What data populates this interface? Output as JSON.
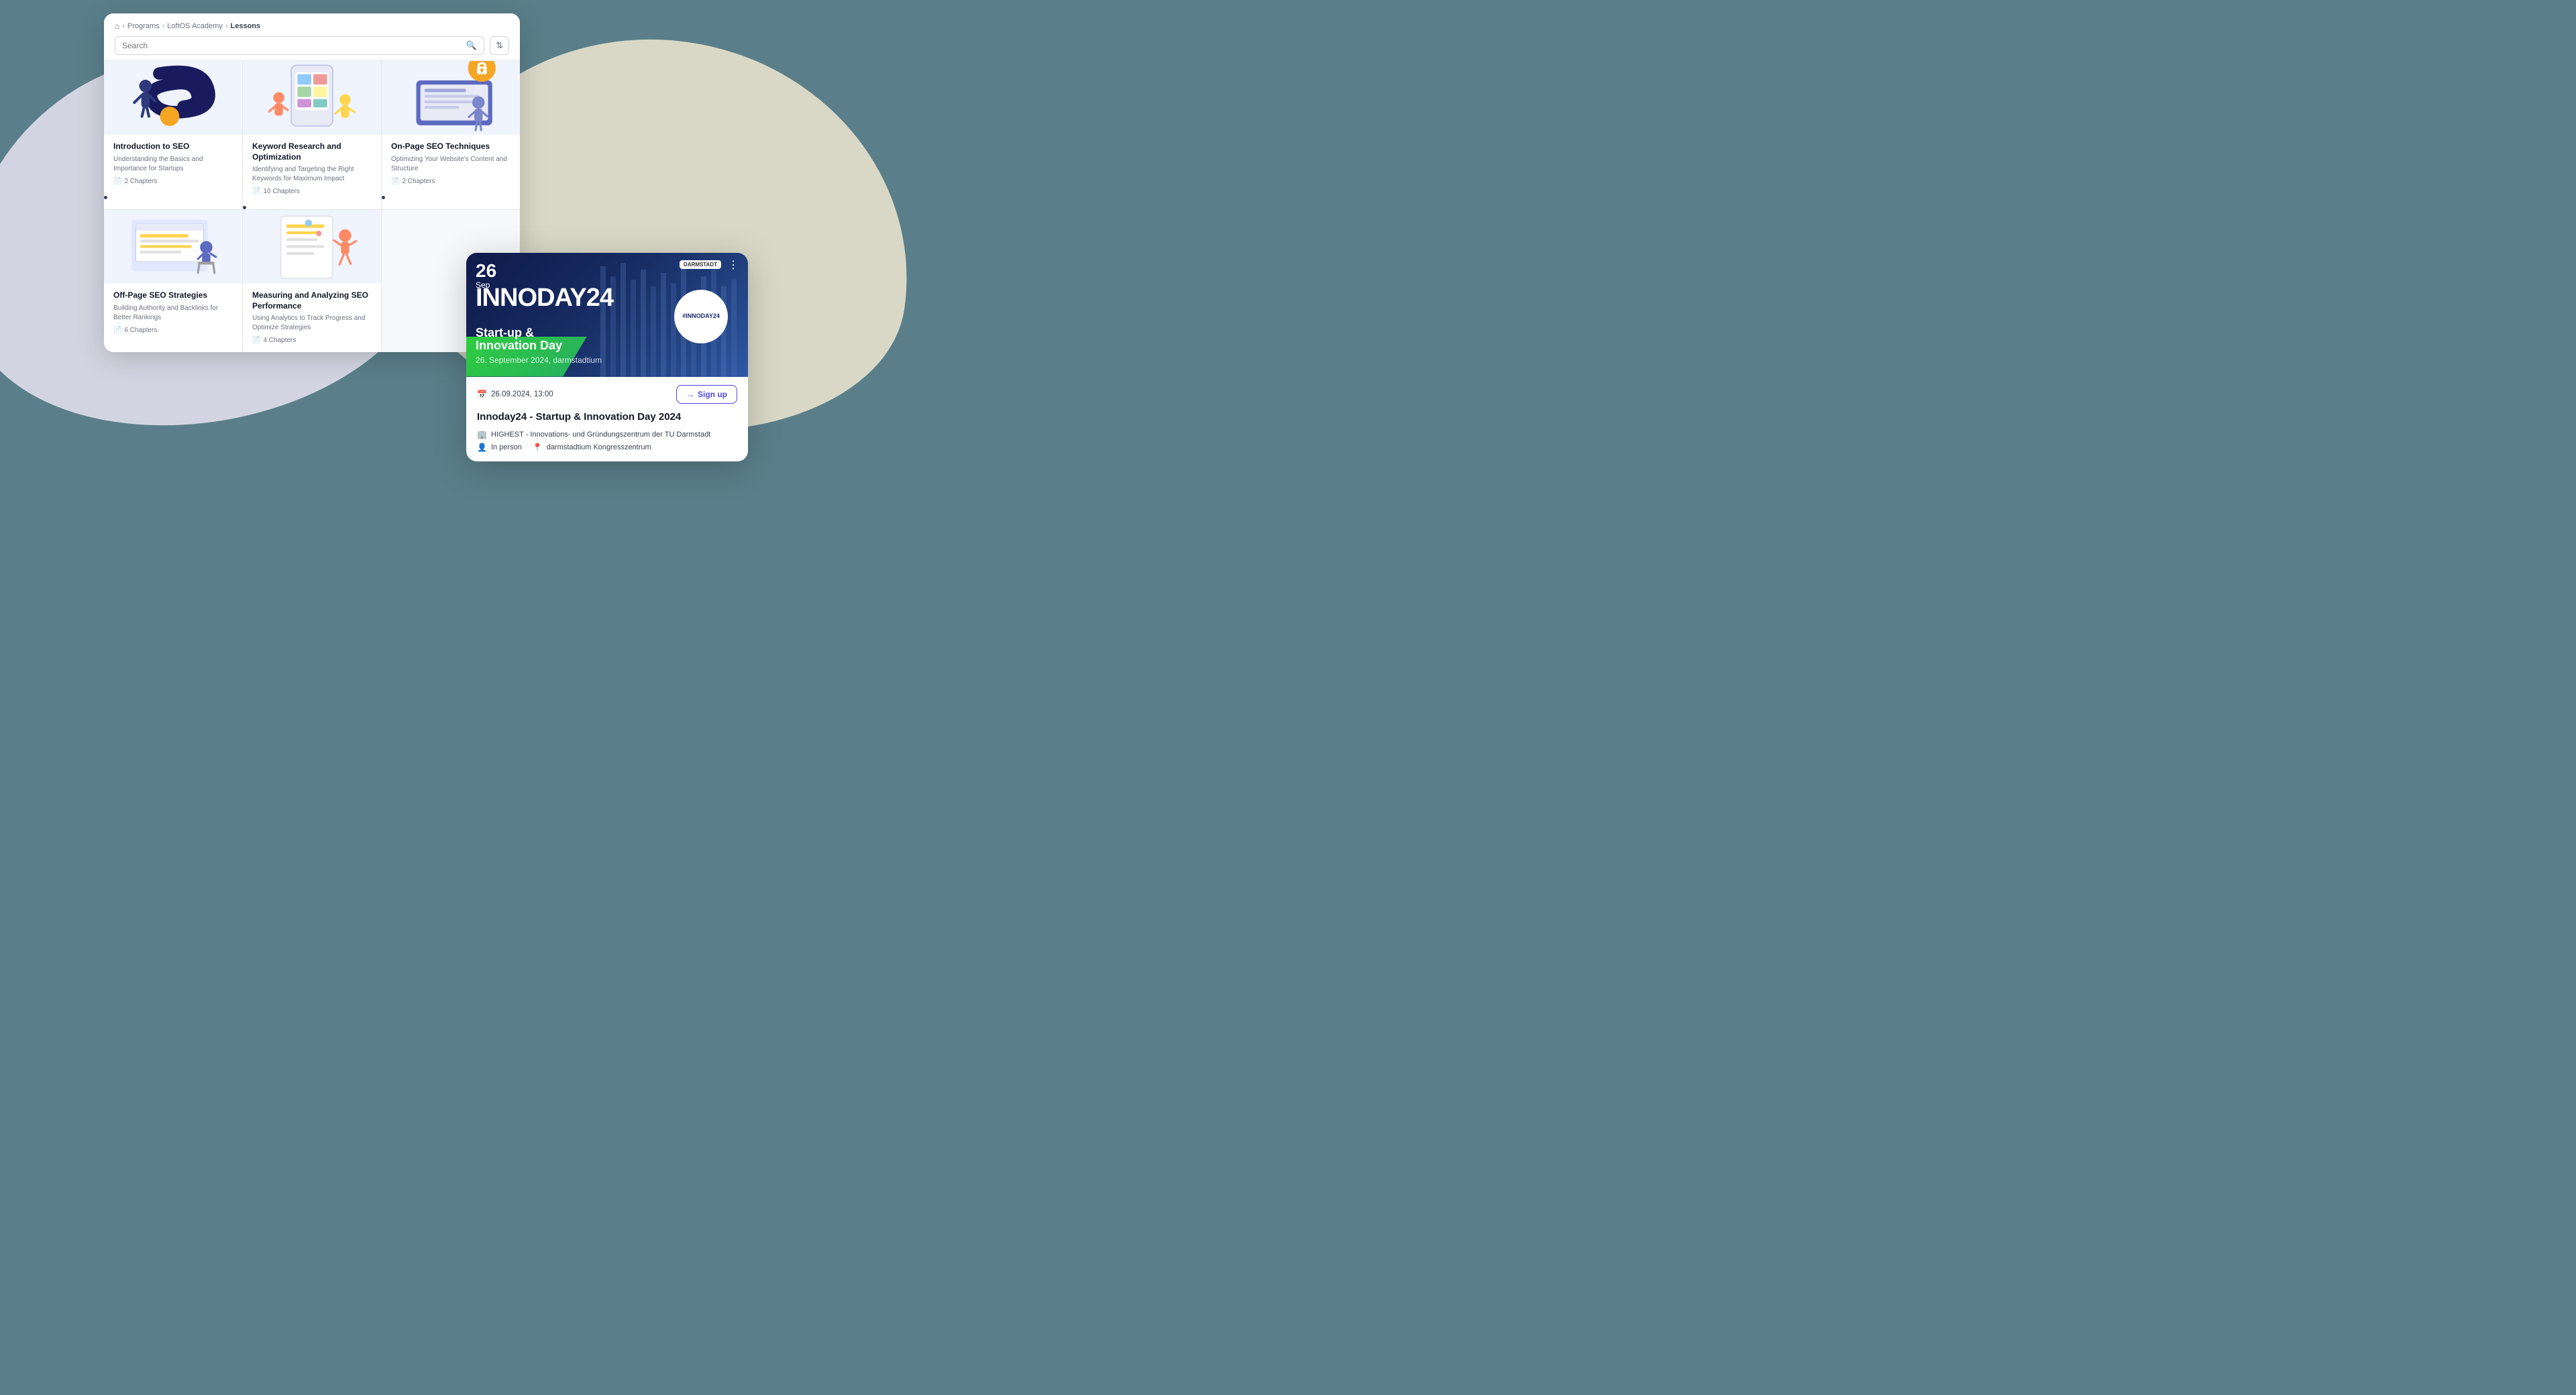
{
  "background": {
    "color": "#5a7f8a"
  },
  "lms": {
    "breadcrumb": {
      "home": "🏠",
      "items": [
        "Programs",
        "LoftOS Academy",
        "Lessons"
      ]
    },
    "search": {
      "placeholder": "Search",
      "filter_icon": "⇅"
    },
    "lessons": [
      {
        "id": 1,
        "title": "Introduction to SEO",
        "description": "Understanding the Basics and Importance for Startups",
        "chapters": "2 Chapters",
        "illustration": "seo1"
      },
      {
        "id": 2,
        "title": "Keyword Research and Optimization",
        "description": "Identifying and Targeting the Right Keywords for Maximum Impact",
        "chapters": "10 Chapters",
        "illustration": "seo2"
      },
      {
        "id": 3,
        "title": "On-Page SEO Techniques",
        "description": "Optimizing Your Website's Content and Structure",
        "chapters": "2 Chapters",
        "illustration": "seo3"
      },
      {
        "id": 4,
        "title": "Off-Page SEO Strategies",
        "description": "Building Authority and Backlinks for Better Rankings",
        "chapters": "6 Chapters",
        "illustration": "seo4"
      },
      {
        "id": 5,
        "title": "Measuring and Analyzing SEO Performance",
        "description": "Using Analytics to Track Progress and Optimize Strategies",
        "chapters": "4 Chapters",
        "illustration": "seo5"
      }
    ]
  },
  "event": {
    "date_day": "26",
    "date_month": "Sep",
    "banner_title": "INNODAY24",
    "banner_subtitle_line1": "Start-up &",
    "banner_subtitle_line2": "Innovation Day",
    "banner_location": "26. September 2024, darmstadtium",
    "circle_logo": "#INNODAY24",
    "org_name": "DARMSTADT",
    "datetime_display": "26.09.2024, 13:00",
    "signup_label": "Sign up",
    "title": "Innoday24 - Startup & Innovation Day 2024",
    "venue": "HIGHEST - Innovations- und Gründungszentrum der TU Darmstadt",
    "format": "In person",
    "location": "darmstadtium Kongresszentrum"
  }
}
